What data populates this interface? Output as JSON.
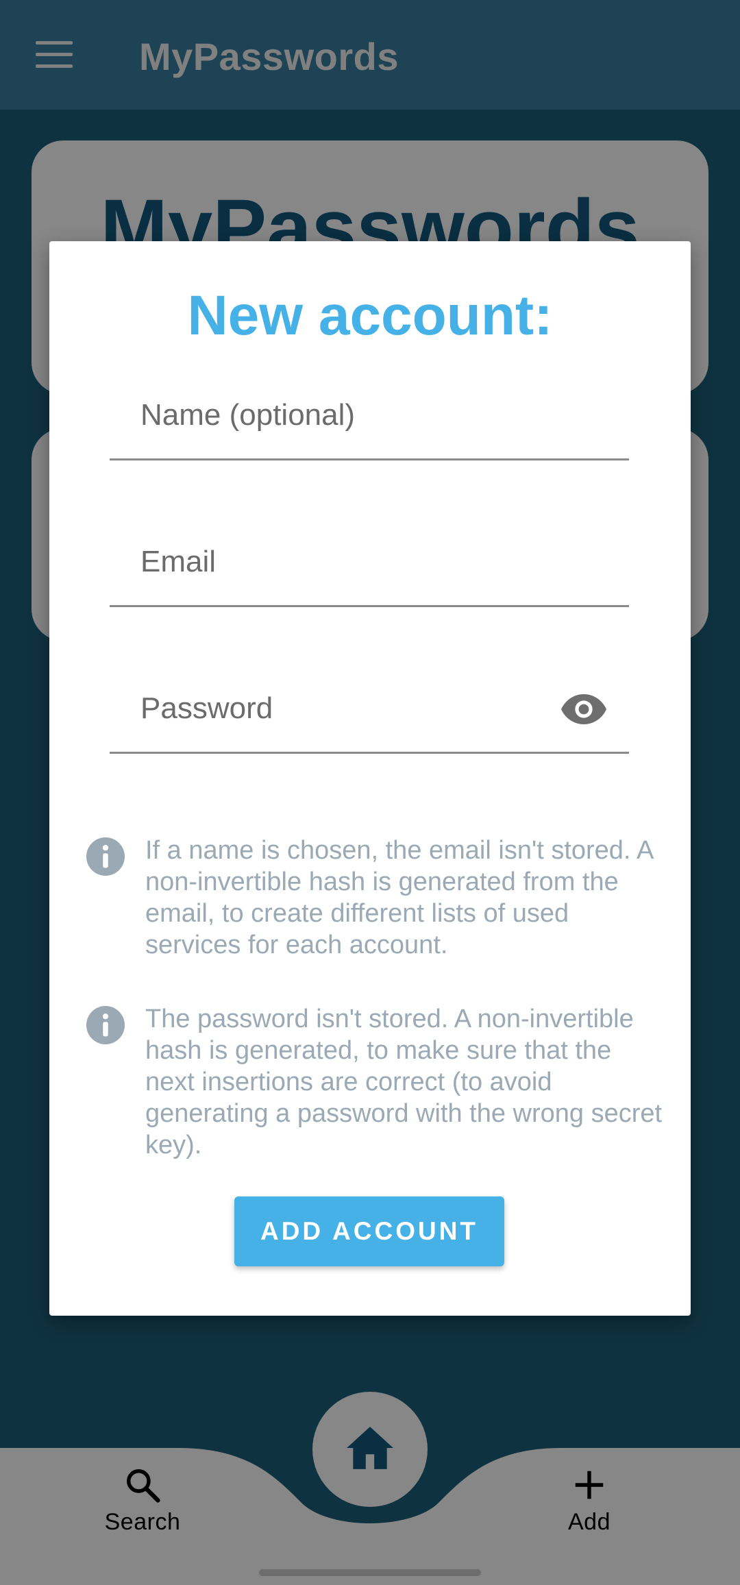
{
  "app": {
    "title": "MyPasswords",
    "card_title": "MyPasswords"
  },
  "dialog": {
    "title": "New account:",
    "fields": {
      "name_placeholder": "Name (optional)",
      "email_placeholder": "Email",
      "password_placeholder": "Password"
    },
    "info": [
      "If a name is chosen, the email isn't stored. A non-invertible hash is generated from the email, to create different lists of used services for each account.",
      "The password isn't stored. A non-invertible hash is generated, to make sure that the next insertions are correct (to avoid generating a password with the wrong secret key)."
    ],
    "submit_label": "ADD ACCOUNT"
  },
  "bottom_nav": {
    "search_label": "Search",
    "add_label": "Add"
  },
  "icons": {
    "menu": "menu-icon",
    "eye": "eye-icon",
    "info": "info-icon",
    "home": "home-icon",
    "search": "search-icon",
    "add": "plus-icon"
  },
  "colors": {
    "accent": "#45b1e6",
    "info_text": "#9aa9b4",
    "primary_dark": "#14597e"
  }
}
